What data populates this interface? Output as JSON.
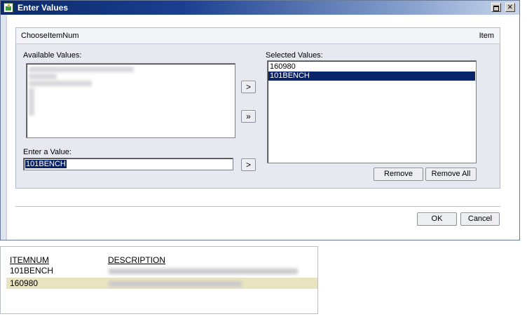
{
  "window": {
    "title": "Enter Values"
  },
  "panel": {
    "title": "ChooseItemNum",
    "type_label": "Item"
  },
  "available": {
    "label": "Available Values:"
  },
  "selected": {
    "label": "Selected Values:",
    "items": [
      "160980",
      "101BENCH"
    ]
  },
  "enter": {
    "label": "Enter a Value:",
    "value": "101BENCH"
  },
  "buttons": {
    "add": ">",
    "add_all": "»",
    "add_value": ">",
    "remove": "Remove",
    "remove_all": "Remove All",
    "ok": "OK",
    "cancel": "Cancel"
  },
  "lookup": {
    "columns": [
      "ITEMNUM",
      "DESCRIPTION"
    ],
    "rows": [
      {
        "itemnum": "101BENCH"
      },
      {
        "itemnum": "160980"
      }
    ],
    "highlight_color": "#e8e4c2"
  },
  "colors": {
    "selection": "#0a246a",
    "titlebar": "#0b2a6b",
    "panel_bg": "#e7e9f0"
  }
}
